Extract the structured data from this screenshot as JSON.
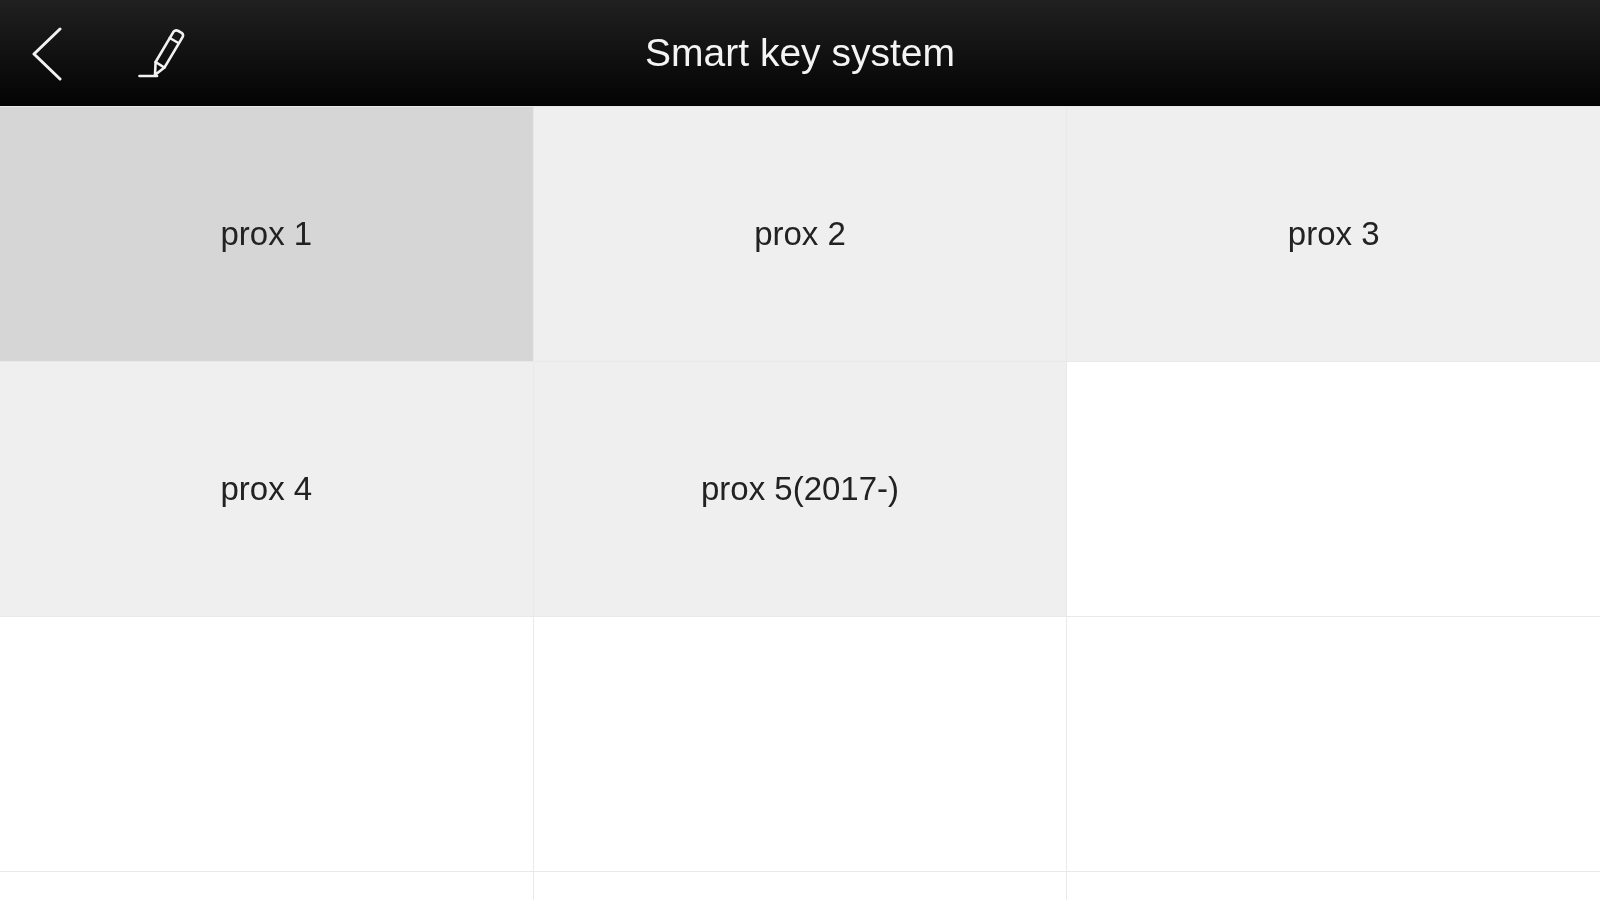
{
  "header": {
    "title": "Smart key system"
  },
  "items": [
    {
      "label": "prox 1",
      "selected": true
    },
    {
      "label": "prox 2",
      "selected": false
    },
    {
      "label": "prox 3",
      "selected": false
    },
    {
      "label": "prox 4",
      "selected": false
    },
    {
      "label": "prox 5(2017-)",
      "selected": false
    }
  ]
}
